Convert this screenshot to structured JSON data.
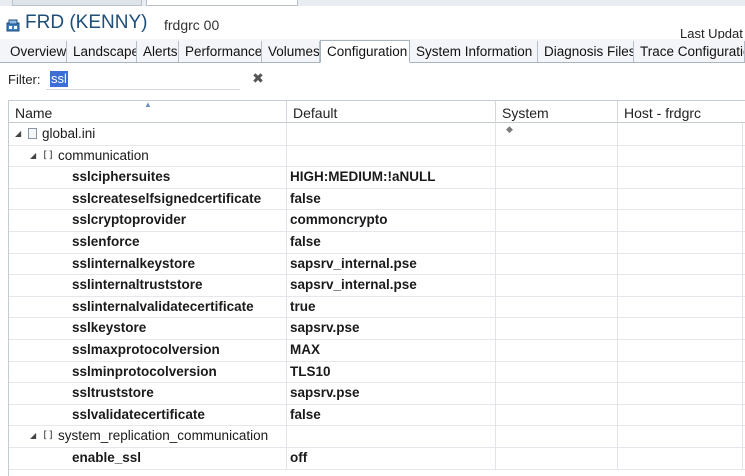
{
  "header": {
    "system_title": "FRD (KENNY)",
    "system_subtitle": "frdgrc 00",
    "last_update": "Last Updat"
  },
  "tabs": [
    {
      "label": "Overview"
    },
    {
      "label": "Landscape"
    },
    {
      "label": "Alerts"
    },
    {
      "label": "Performance"
    },
    {
      "label": "Volumes"
    },
    {
      "label": "Configuration",
      "active": true
    },
    {
      "label": "System Information"
    },
    {
      "label": "Diagnosis Files"
    },
    {
      "label": "Trace Configuratio"
    }
  ],
  "filter": {
    "label": "Filter:",
    "value": "ssl"
  },
  "columns": {
    "name": "Name",
    "default": "Default",
    "system": "System",
    "host": "Host - frdgrc"
  },
  "tree": {
    "file": "global.ini",
    "section1": "communication",
    "section2": "system_replication_communication"
  },
  "params": [
    {
      "name": "sslciphersuites",
      "default": "HIGH:MEDIUM:!aNULL"
    },
    {
      "name": "sslcreateselfsignedcertificate",
      "default": "false"
    },
    {
      "name": "sslcryptoprovider",
      "default": "commoncrypto"
    },
    {
      "name": "sslenforce",
      "default": "false"
    },
    {
      "name": "sslinternalkeystore",
      "default": "sapsrv_internal.pse"
    },
    {
      "name": "sslinternaltruststore",
      "default": "sapsrv_internal.pse"
    },
    {
      "name": "sslinternalvalidatecertificate",
      "default": "true"
    },
    {
      "name": "sslkeystore",
      "default": "sapsrv.pse"
    },
    {
      "name": "sslmaxprotocolversion",
      "default": "MAX"
    },
    {
      "name": "sslminprotocolversion",
      "default": "TLS10"
    },
    {
      "name": "ssltruststore",
      "default": "sapsrv.pse"
    },
    {
      "name": "sslvalidatecertificate",
      "default": "false"
    }
  ],
  "params2": [
    {
      "name": "enable_ssl",
      "default": "off"
    }
  ],
  "colors": {
    "title_blue": "#1f4e79",
    "selection_blue": "#3b6fd6"
  }
}
